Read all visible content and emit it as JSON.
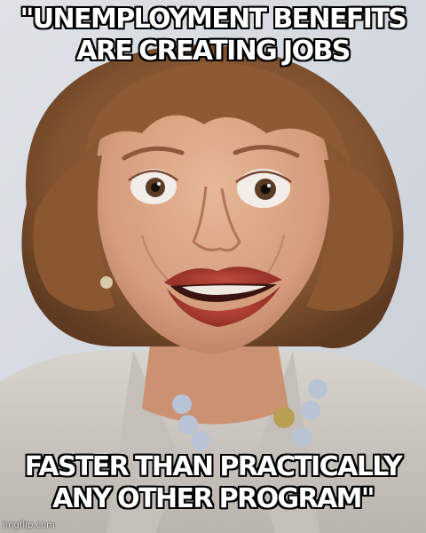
{
  "meme": {
    "top_text": "\"UNEMPLOYMENT BENEFITS ARE CREATING JOBS",
    "bottom_text": "FASTER THAN PRACTICALLY ANY OTHER PROGRAM\"",
    "watermark": "imgflip.com"
  },
  "colors": {
    "caption_fill": "#ffffff",
    "caption_stroke": "#000000",
    "background": "#d9dde2",
    "hair": "#8a5a35",
    "skin": "#d9a583",
    "lips": "#a8352b",
    "jacket": "#cfcac3",
    "necklace": "#b9c3d6"
  }
}
